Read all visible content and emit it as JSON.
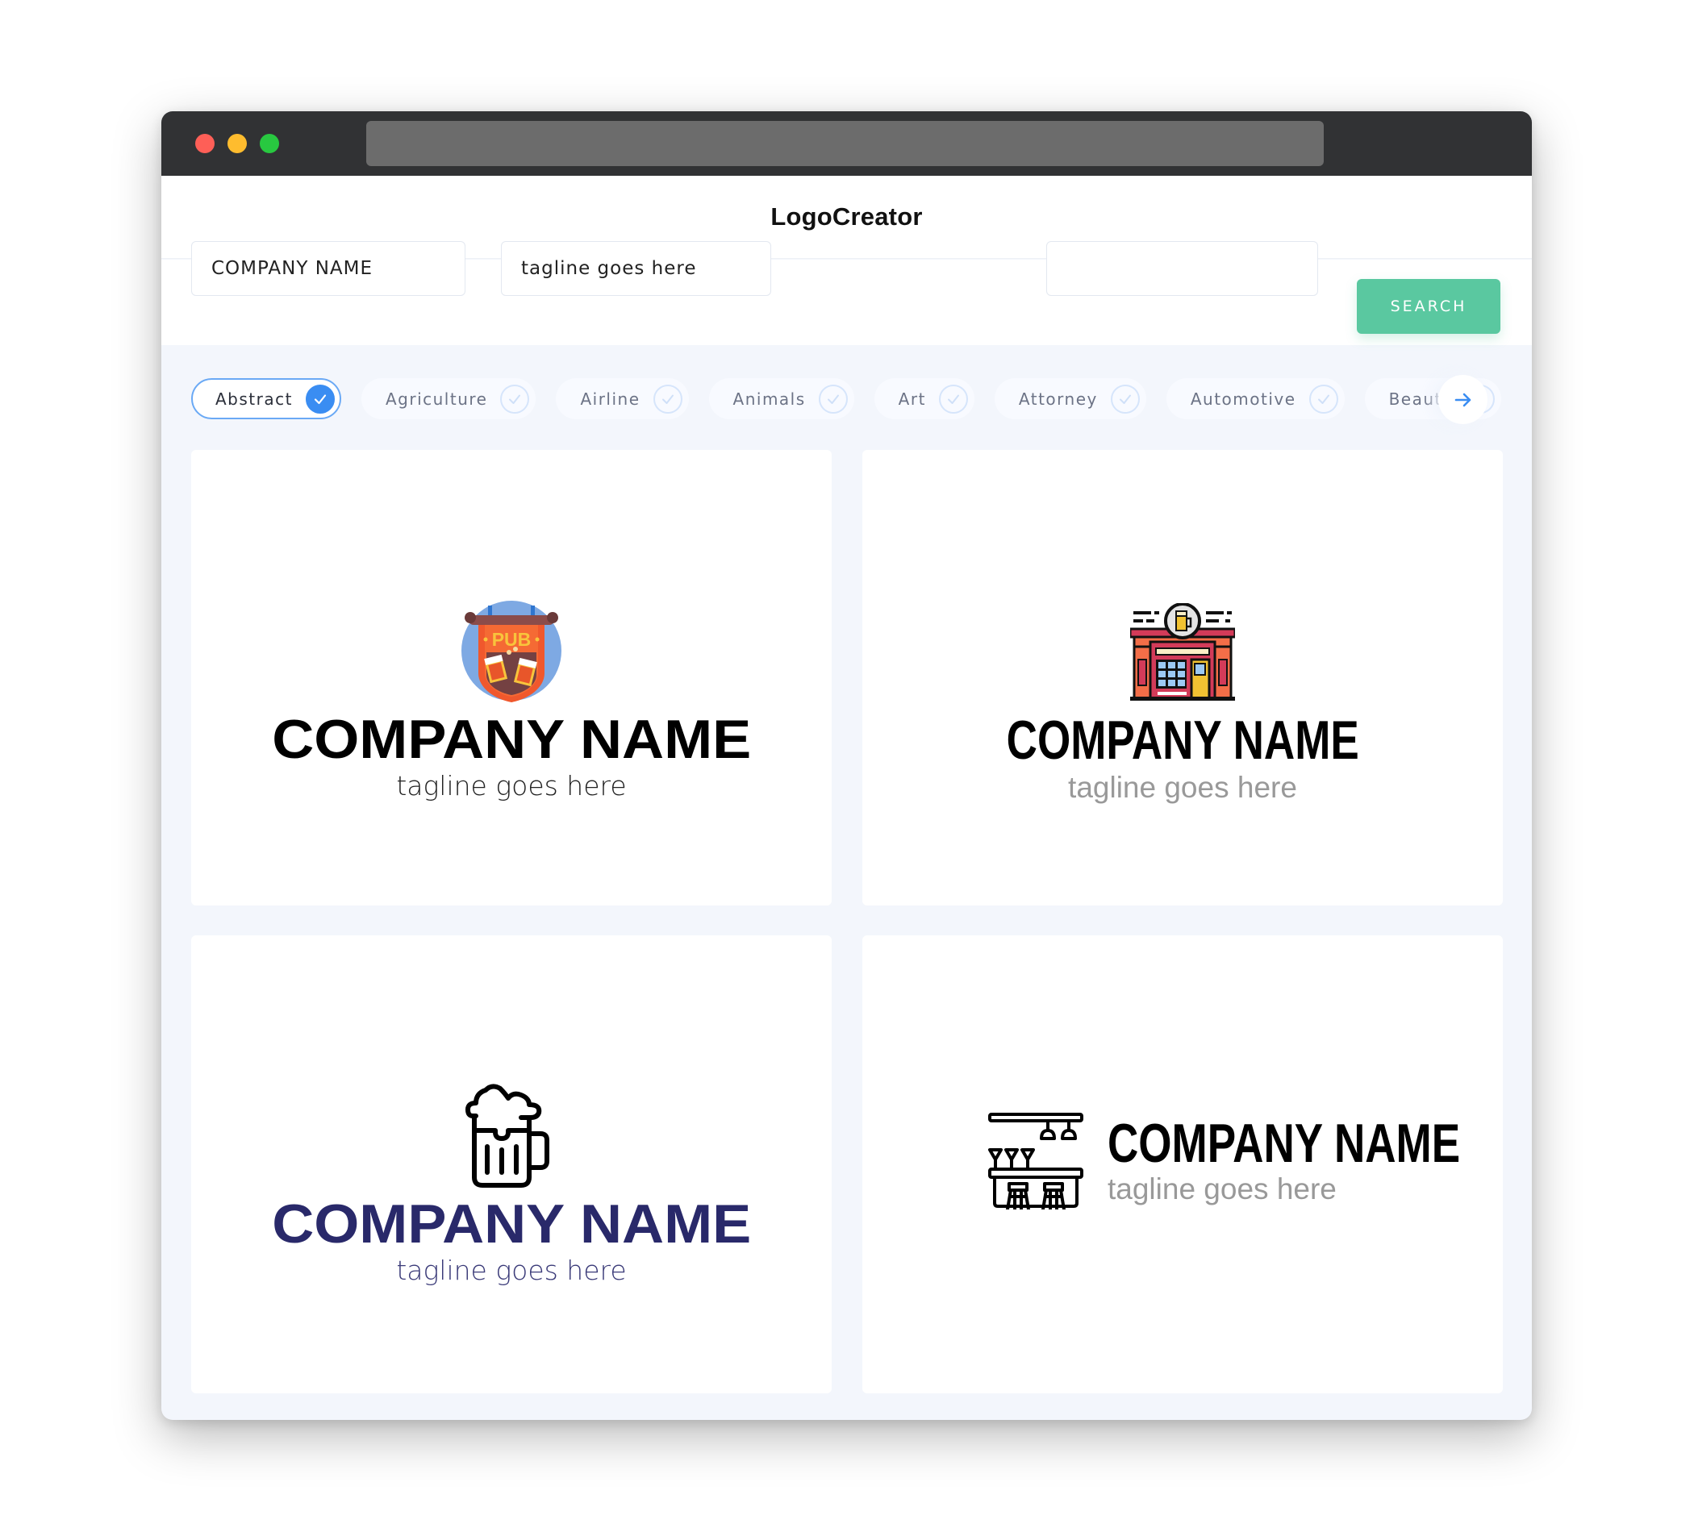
{
  "window": {
    "traffic_lights": [
      "close",
      "minimize",
      "maximize"
    ],
    "url": ""
  },
  "header": {
    "title": "LogoCreator"
  },
  "search": {
    "company_value": "COMPANY NAME",
    "tagline_value": "tagline goes here",
    "extra_value": "",
    "button_label": "SEARCH",
    "accent_color": "#5ac8a0"
  },
  "categories": {
    "items": [
      {
        "label": "Abstract",
        "selected": true
      },
      {
        "label": "Agriculture",
        "selected": false
      },
      {
        "label": "Airline",
        "selected": false
      },
      {
        "label": "Animals",
        "selected": false
      },
      {
        "label": "Art",
        "selected": false
      },
      {
        "label": "Attorney",
        "selected": false
      },
      {
        "label": "Automotive",
        "selected": false
      },
      {
        "label": "Beauty",
        "selected": false
      }
    ],
    "next_icon": "arrow-right-icon",
    "active_color": "#3a8df2"
  },
  "logos": [
    {
      "icon": "pub-sign-icon",
      "company": "COMPANY NAME",
      "tagline": "tagline goes here",
      "layout": "stacked",
      "name_color": "#000000",
      "tagline_color": "#222222"
    },
    {
      "icon": "pub-building-icon",
      "company": "COMPANY NAME",
      "tagline": "tagline goes here",
      "layout": "stacked",
      "name_color": "#000000",
      "tagline_color": "#999999"
    },
    {
      "icon": "beer-mug-icon",
      "company": "COMPANY NAME",
      "tagline": "tagline goes here",
      "layout": "stacked",
      "name_color": "#29296a",
      "tagline_color": "#3a3a78"
    },
    {
      "icon": "bar-counter-icon",
      "company": "COMPANY NAME",
      "tagline": "tagline goes here",
      "layout": "inline",
      "name_color": "#000000",
      "tagline_color": "#999999"
    }
  ]
}
